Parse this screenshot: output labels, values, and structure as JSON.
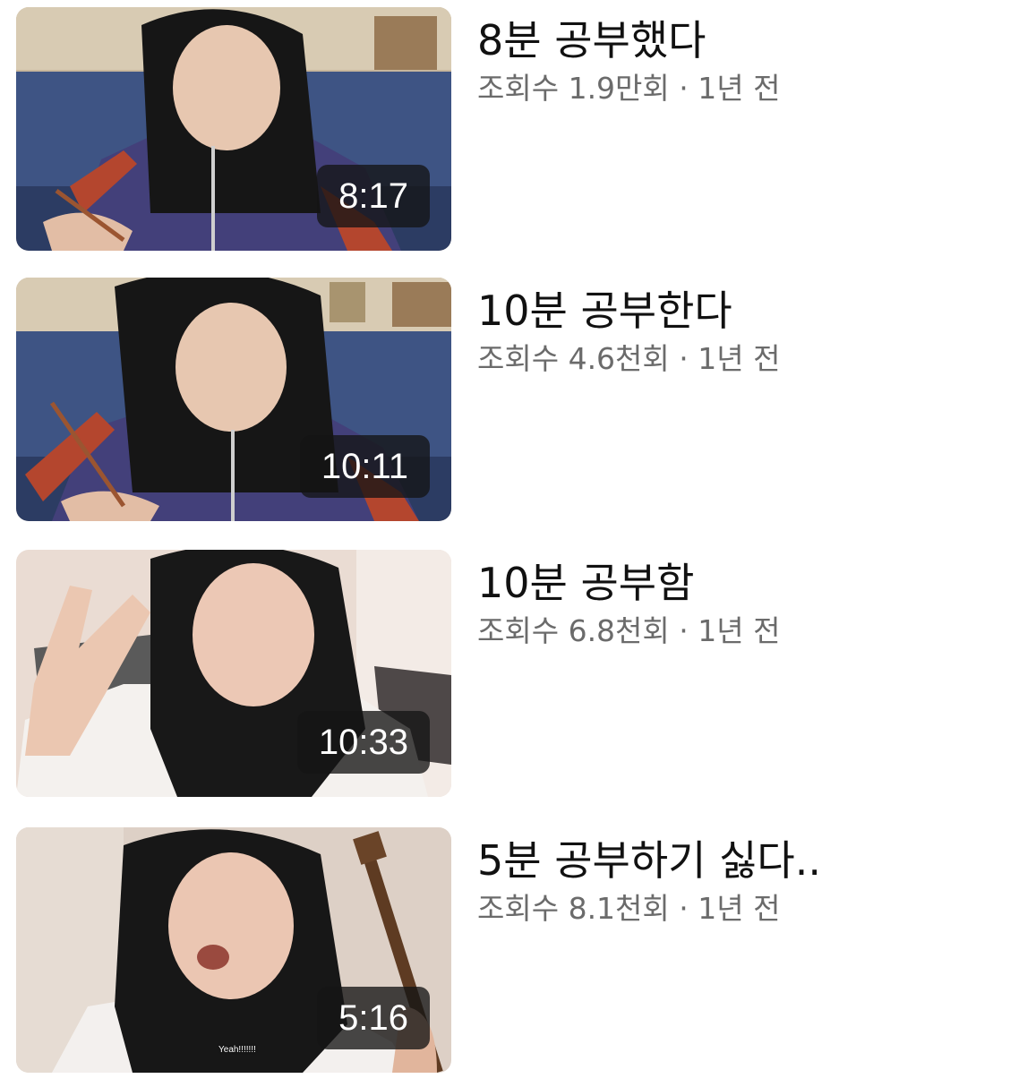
{
  "videos": [
    {
      "title": "8분 공부했다",
      "views": "조회수 1.9만회",
      "separator": "·",
      "age": "1년 전",
      "duration": "8:17",
      "thumbnail_icon": "studying-thumbnail-image"
    },
    {
      "title": "10분 공부한다",
      "views": "조회수 4.6천회",
      "separator": "·",
      "age": "1년 전",
      "duration": "10:11",
      "thumbnail_icon": "studying-thumbnail-image"
    },
    {
      "title": "10분 공부함",
      "views": "조회수 6.8천회",
      "separator": "·",
      "age": "1년 전",
      "duration": "10:33",
      "thumbnail_icon": "peace-sign-thumbnail-image"
    },
    {
      "title": "5분 공부하기 싫다..",
      "views": "조회수 8.1천회",
      "separator": "·",
      "age": "1년 전",
      "duration": "5:16",
      "thumbnail_icon": "guitar-thumbnail-image",
      "thumbnail_caption": "Yeah!!!!!!!"
    }
  ]
}
